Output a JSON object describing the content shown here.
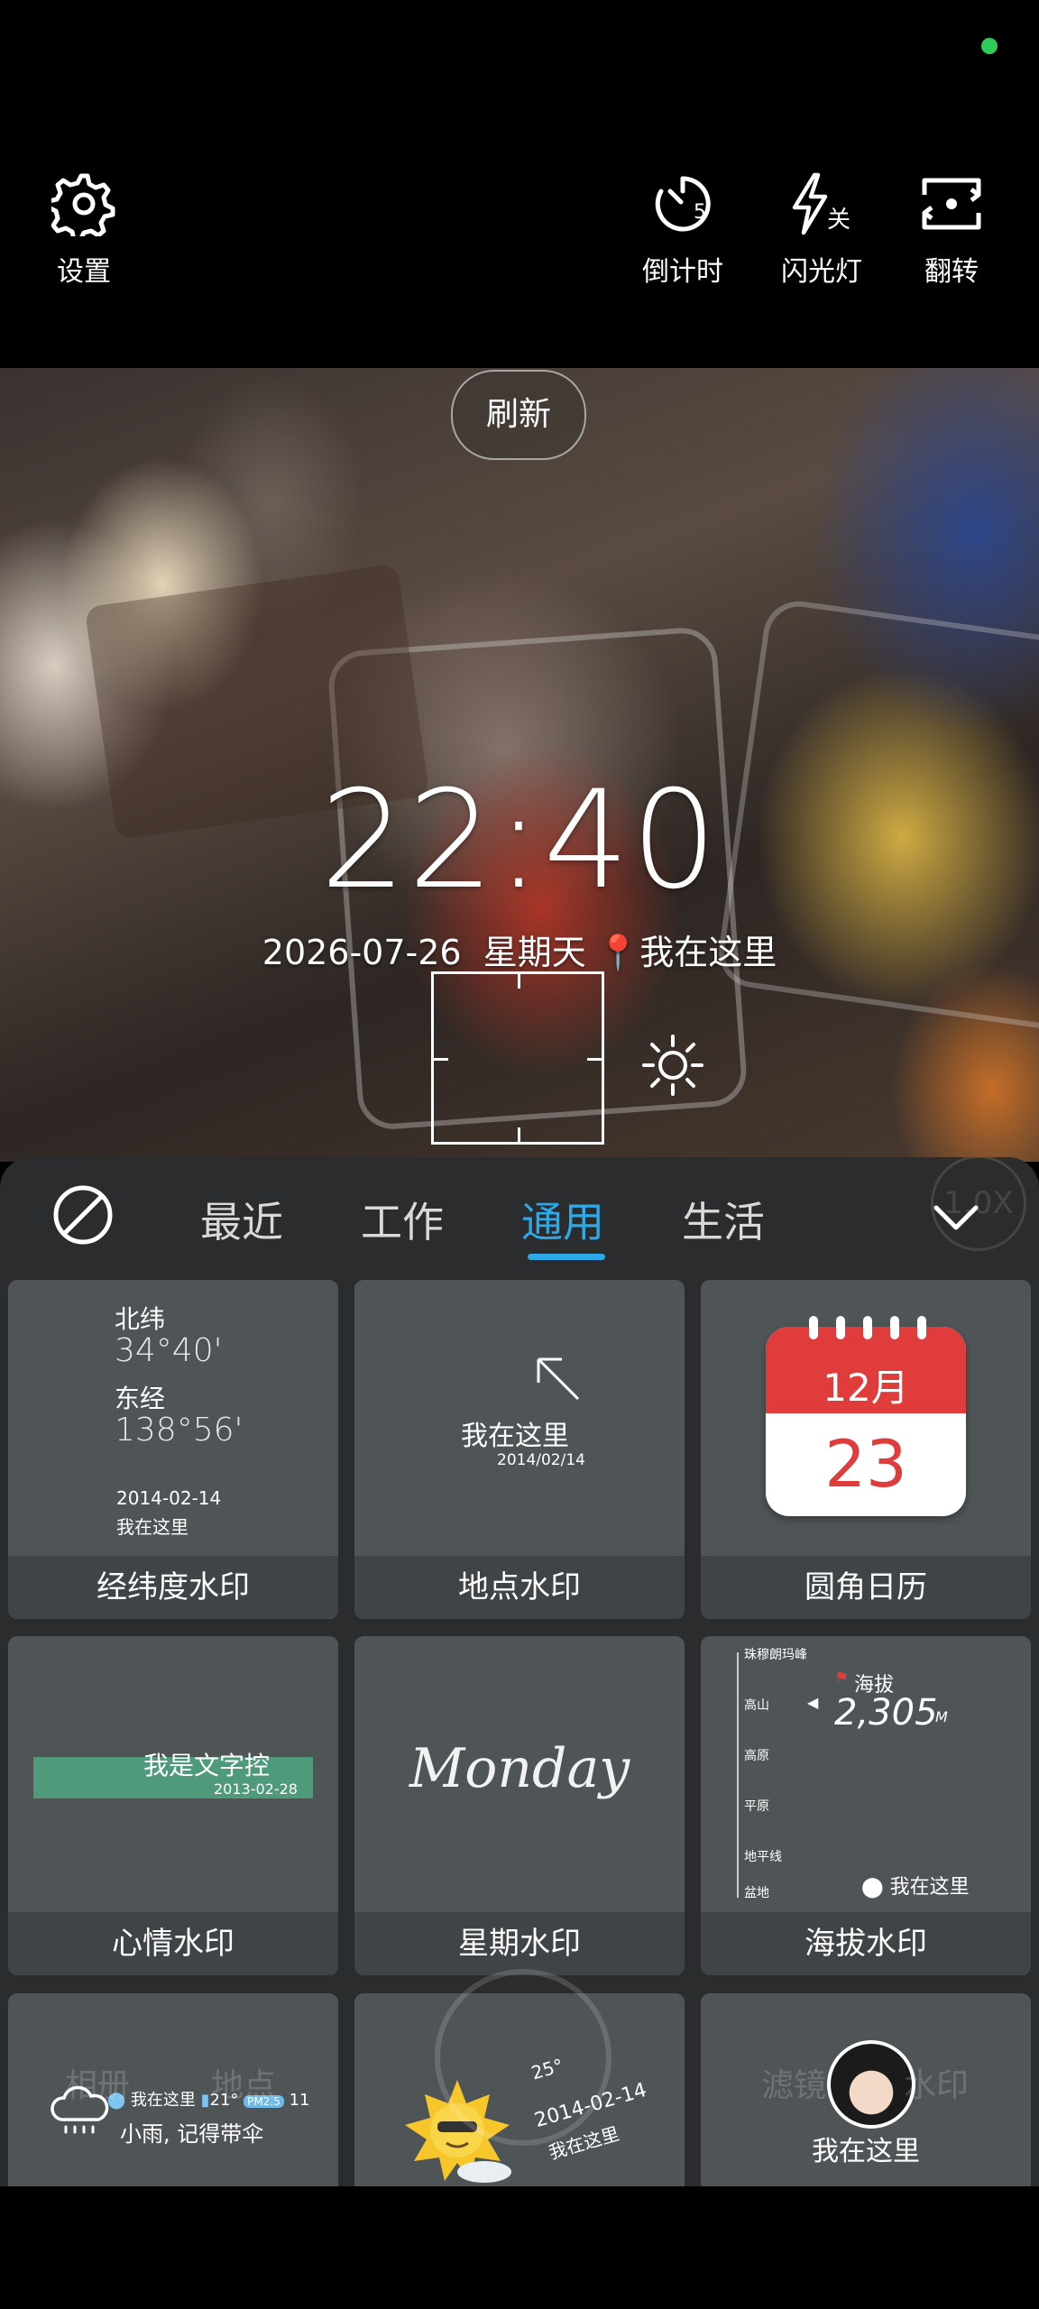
{
  "toolbar": {
    "settings_label": "设置",
    "timer_label": "倒计时",
    "timer_value": "5",
    "flash_label": "闪光灯",
    "flash_state": "关",
    "flip_label": "翻转"
  },
  "camera": {
    "refresh_label": "刷新",
    "time": "22:40",
    "date": "2026-07-26",
    "weekday": "星期天",
    "location": "我在这里"
  },
  "sheet": {
    "tabs": [
      "最近",
      "工作",
      "通用",
      "生活"
    ],
    "active_tab": "通用",
    "zoom_hint": "1.0X",
    "cards": [
      {
        "caption": "经纬度水印",
        "lat_label": "北纬",
        "lat_value": "34°40'",
        "lon_label": "东经",
        "lon_value": "138°56'",
        "date": "2014-02-14",
        "place": "我在这里"
      },
      {
        "caption": "地点水印",
        "place": "我在这里",
        "date": "2014/02/14"
      },
      {
        "caption": "圆角日历",
        "month": "12月",
        "day": "23"
      },
      {
        "caption": "心情水印",
        "text": "我是文字控",
        "date": "2013-02-28"
      },
      {
        "caption": "星期水印",
        "text": "Monday"
      },
      {
        "caption": "海拔水印",
        "scale": [
          "珠穆朗玛峰",
          "高山",
          "高原",
          "平原",
          "地平线",
          "盆地"
        ],
        "flag_label": "海拔",
        "value": "2,305",
        "unit": "M",
        "place": "我在这里"
      },
      {
        "place": "我在这里",
        "temp": "21°",
        "aqi": "PM2.5",
        "aqi_value": "11",
        "weather_text": "小雨, 记得带伞"
      },
      {
        "temp": "25°",
        "date": "2014-02-14",
        "place": "我在这里"
      },
      {
        "place": "我在这里"
      }
    ]
  },
  "bottom_nav": [
    "相册",
    "地点",
    "滤镜",
    "水印"
  ],
  "colors": {
    "accent": "#2ea8e6",
    "status_dot": "#2ecc57",
    "calendar_red": "#e03c3c",
    "mood_green": "#4f9a7b"
  }
}
